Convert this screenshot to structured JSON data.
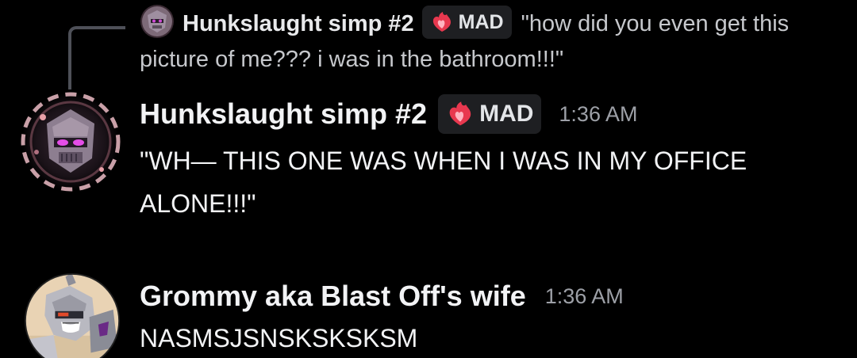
{
  "reply": {
    "author": "Hunkslaught simp #2",
    "tag_label": "MAD",
    "text": "\"how did you even get this picture of me??? i was in the bathroom!!!\""
  },
  "messages": [
    {
      "author": "Hunkslaught simp #2",
      "tag_label": "MAD",
      "timestamp": "1:36 AM",
      "content": "\"WH— THIS ONE WAS WHEN I WAS IN MY OFFICE ALONE!!!\""
    },
    {
      "author": "Grommy aka Blast Off's wife",
      "timestamp": "1:36 AM",
      "content": "NASMSJSNSKSKSKSM"
    }
  ],
  "colors": {
    "background": "#000000",
    "tag_background": "#1e1f22",
    "timestamp": "#9da0a7",
    "reply_spine": "#4e5058",
    "tag_icon": "#e8384f"
  },
  "icons": {
    "tag": "flame-heart-icon",
    "avatar_1": "robot-avatar-purple",
    "avatar_2": "robot-avatar-grey"
  }
}
